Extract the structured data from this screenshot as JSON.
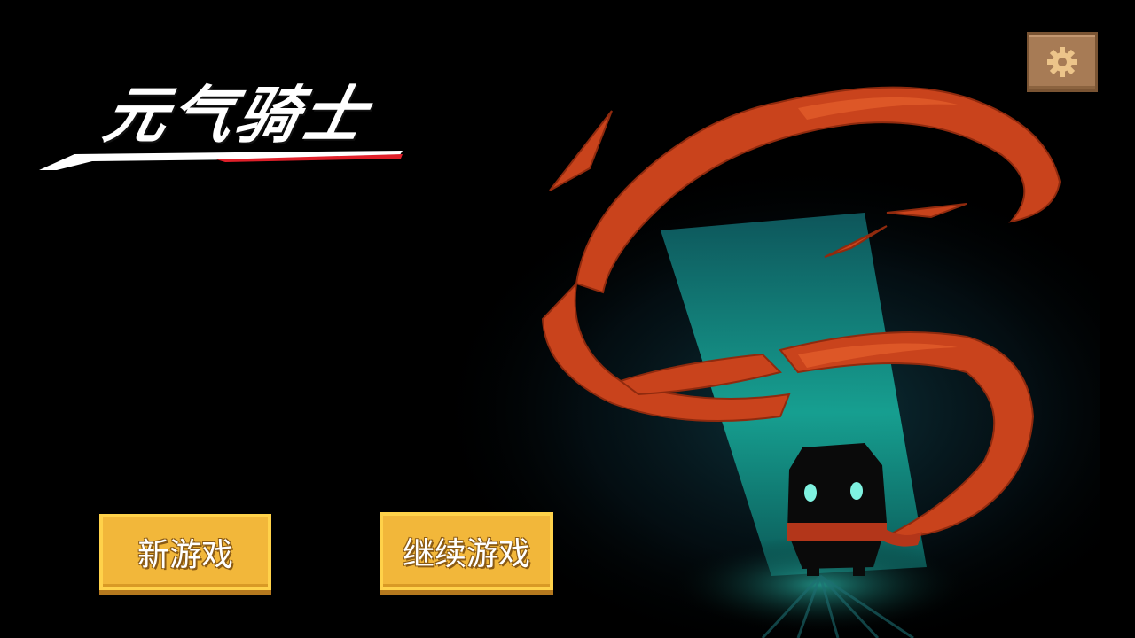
{
  "logo": {
    "title": "元气骑士"
  },
  "settings": {
    "icon": "gear-icon"
  },
  "menu": {
    "new_game_label": "新游戏",
    "continue_game_label": "继续游戏"
  },
  "colors": {
    "background": "#000000",
    "light_beam": "#1fb5a4",
    "scarf": "#c9431c",
    "button_fill": "#f2b73a",
    "button_border": "#ffd24a",
    "settings_fill": "#a77b55",
    "logo_accent": "#e0202a"
  }
}
